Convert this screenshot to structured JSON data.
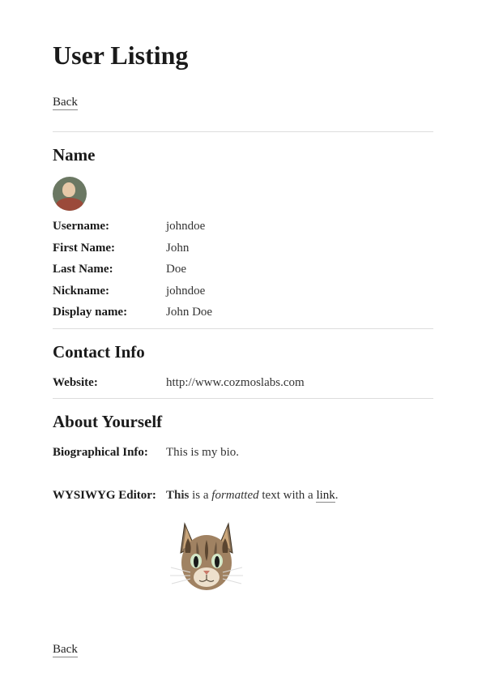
{
  "page": {
    "title": "User Listing",
    "back_label": "Back"
  },
  "sections": {
    "name": {
      "heading": "Name",
      "username_label": "Username:",
      "username_value": "johndoe",
      "firstname_label": "First Name:",
      "firstname_value": "John",
      "lastname_label": "Last Name:",
      "lastname_value": "Doe",
      "nickname_label": "Nickname:",
      "nickname_value": "johndoe",
      "displayname_label": "Display name:",
      "displayname_value": "John Doe"
    },
    "contact": {
      "heading": "Contact Info",
      "website_label": "Website:",
      "website_value": "http://www.cozmoslabs.com"
    },
    "about": {
      "heading": "About Yourself",
      "bio_label": "Biographical Info:",
      "bio_value": "This is my bio.",
      "wysiwyg_label": "WYSIWYG Editor:",
      "wysiwyg_bold": "This",
      "wysiwyg_mid1": " is a ",
      "wysiwyg_italic": "formatted",
      "wysiwyg_mid2": " text with a ",
      "wysiwyg_link": "link",
      "wysiwyg_end": "."
    }
  }
}
